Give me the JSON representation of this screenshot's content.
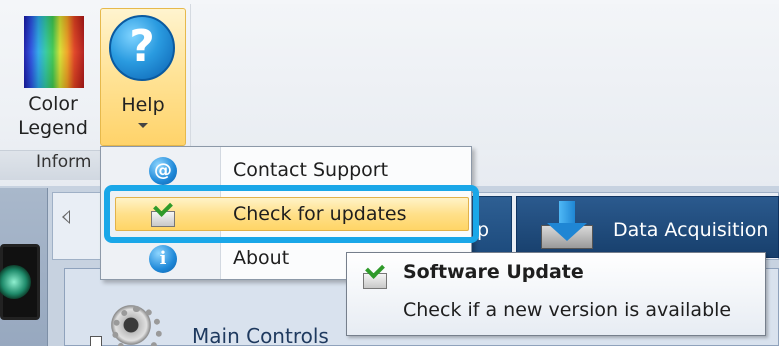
{
  "ribbon": {
    "color_legend": {
      "line1": "Color",
      "line2": "Legend",
      "icon": "color-gradient-icon"
    },
    "help": {
      "label": "Help",
      "icon": "help-icon",
      "glyph": "?"
    },
    "group_label": "Inform"
  },
  "help_menu": {
    "items": [
      {
        "label": "Contact Support",
        "icon": "at-sign-icon",
        "glyph": "@"
      },
      {
        "label": "Check for updates",
        "icon": "software-update-icon",
        "highlighted": true
      },
      {
        "label": "About",
        "icon": "info-icon",
        "glyph": "i"
      }
    ]
  },
  "tooltip": {
    "title": "Software Update",
    "description": "Check if a new version is available",
    "icon": "software-update-icon"
  },
  "tabs": {
    "partial_label": "p",
    "data_acquisition": "Data Acquisition",
    "data_acquisition_icon": "download-icon"
  },
  "panel": {
    "main_controls": "Main Controls",
    "icon": "gear-icon"
  },
  "colors": {
    "highlight_ring": "#1aa7e8",
    "menu_highlight": "#ffe08a",
    "tab_active": "#1c4a7c"
  }
}
